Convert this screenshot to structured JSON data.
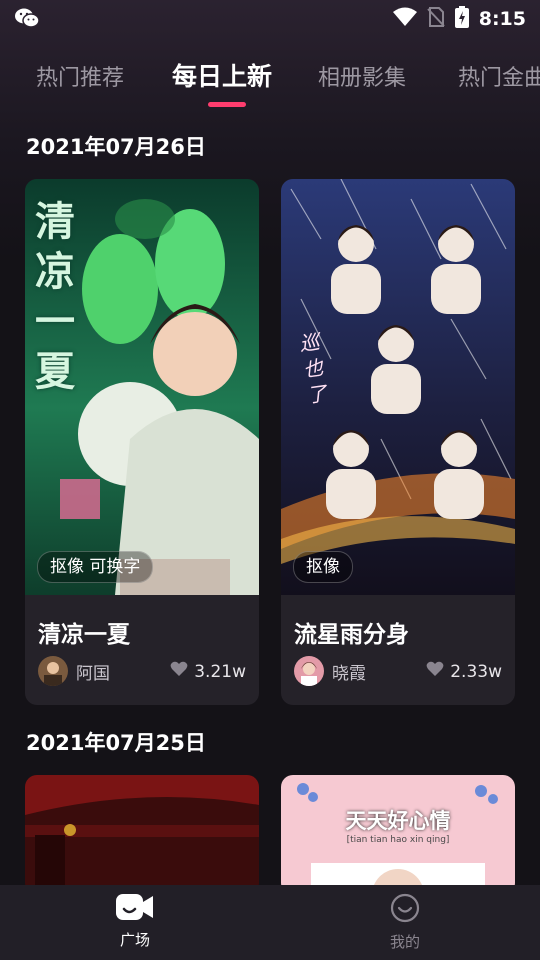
{
  "status_bar": {
    "time": "8:15"
  },
  "tabs": [
    {
      "label": "热门推荐"
    },
    {
      "label": "每日上新"
    },
    {
      "label": "相册影集"
    },
    {
      "label": "热门金曲"
    }
  ],
  "sections": [
    {
      "date": "2021年07月26日",
      "cards": [
        {
          "overlay_text": "清凉一夏",
          "tag": "抠像 可换字",
          "title": "清凉一夏",
          "author": "阿国",
          "likes": "3.21w"
        },
        {
          "overlay_text": "巡也了",
          "tag": "抠像",
          "title": "流星雨分身",
          "author": "晓霞",
          "likes": "2.33w"
        }
      ]
    },
    {
      "date": "2021年07月25日",
      "cards": [
        {
          "overlay_text": ""
        },
        {
          "overlay_text": "天天好心情",
          "overlay_subtext": "[tian tian hao xin qing]"
        }
      ]
    }
  ],
  "bottom_nav": [
    {
      "label": "广场",
      "icon": "video-icon",
      "active": true
    },
    {
      "label": "我的",
      "icon": "smile-icon",
      "active": false
    }
  ],
  "colors": {
    "accent": "#ff3d6e",
    "background": "#141217",
    "card": "#252229"
  }
}
